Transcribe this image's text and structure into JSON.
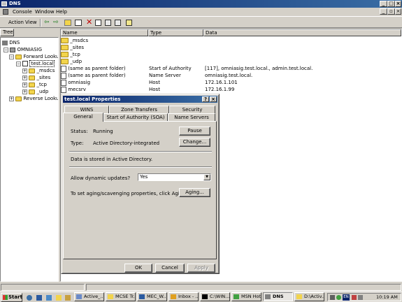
{
  "window": {
    "title": "DNS"
  },
  "menu": {
    "console": "Console",
    "window": "Window",
    "help": "Help"
  },
  "toolbar": {
    "action": "Action",
    "view": "View"
  },
  "tree": {
    "tab": "Tree",
    "root": "DNS",
    "server": "OMNIASIG",
    "forward": "Forward Lookup Z",
    "zone": "test.local",
    "subs": [
      "_msdcs",
      "_sites",
      "_tcp",
      "_udp"
    ],
    "reverse": "Reverse Lookup Z"
  },
  "columns": {
    "name": "Name",
    "type": "Type",
    "data": "Data"
  },
  "records": [
    {
      "name": "_msdcs",
      "type": "",
      "data": "",
      "icon": "folder-icon"
    },
    {
      "name": "_sites",
      "type": "",
      "data": "",
      "icon": "folder-icon"
    },
    {
      "name": "_tcp",
      "type": "",
      "data": "",
      "icon": "folder-icon"
    },
    {
      "name": "_udp",
      "type": "",
      "data": "",
      "icon": "folder-icon"
    },
    {
      "name": "(same as parent folder)",
      "type": "Start of Authority",
      "data": "[117], omniasig.test.local., admin.test.local.",
      "icon": "record-icon"
    },
    {
      "name": "(same as parent folder)",
      "type": "Name Server",
      "data": "omniasig.test.local.",
      "icon": "record-icon"
    },
    {
      "name": "omniasig",
      "type": "Host",
      "data": "172.16.1.101",
      "icon": "record-icon"
    },
    {
      "name": "mecsrv",
      "type": "Host",
      "data": "172.16.1.99",
      "icon": "record-icon"
    }
  ],
  "dialog": {
    "title": "test.local Properties",
    "help_btn": "?",
    "close_btn": "×",
    "tabs_row1": [
      "WINS",
      "Zone Transfers",
      "Security"
    ],
    "tabs_row2": [
      "General",
      "Start of Authority (SOA)",
      "Name Servers"
    ],
    "status_label": "Status:",
    "status_value": "Running",
    "pause": "Pause",
    "type_label": "Type:",
    "type_value": "Active Directory-integrated",
    "change": "Change...",
    "stored": "Data is stored in Active Directory.",
    "dyn_label": "Allow dynamic updates?",
    "dyn_value": "Yes",
    "aging_text": "To set aging/scavenging properties, click Aging.",
    "aging": "Aging...",
    "ok": "OK",
    "cancel": "Cancel",
    "apply": "Apply"
  },
  "taskbar": {
    "start": "Start",
    "items": [
      "Active_...",
      "MCSE Tr...",
      "MEC_W...",
      "Inbox - ...",
      "C:\\WIN...",
      "MSN Hot...",
      "DNS",
      "D:\\Activ..."
    ],
    "lang": "EN",
    "clock": "10:19 AM"
  },
  "colors": {
    "title_start": "#0a246a",
    "title_end": "#3a6ea5",
    "face": "#d4d0c8"
  }
}
